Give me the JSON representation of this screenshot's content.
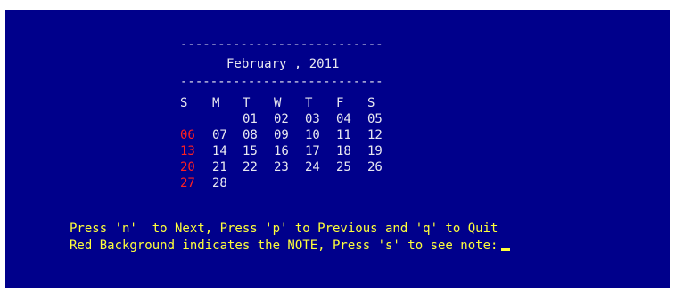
{
  "calendar": {
    "separator": "---------------------------",
    "title": "February , 2011",
    "weekdays": [
      "S",
      "M",
      "T",
      "W",
      "T",
      "F",
      "S"
    ],
    "weeks": [
      [
        "",
        "",
        "01",
        "02",
        "03",
        "04",
        "05"
      ],
      [
        "06",
        "07",
        "08",
        "09",
        "10",
        "11",
        "12"
      ],
      [
        "13",
        "14",
        "15",
        "16",
        "17",
        "18",
        "19"
      ],
      [
        "20",
        "21",
        "22",
        "23",
        "24",
        "25",
        "26"
      ],
      [
        "27",
        "28",
        "",
        "",
        "",
        "",
        ""
      ]
    ],
    "sunday_color": "#ff2020",
    "text_color": "#e8e8f0"
  },
  "prompts": {
    "line1": "Press 'n'  to Next, Press 'p' to Previous and 'q' to Quit",
    "line2": "Red Background indicates the NOTE, Press 's' to see note:"
  },
  "colors": {
    "background": "#00008b",
    "prompt": "#ffff3a"
  }
}
